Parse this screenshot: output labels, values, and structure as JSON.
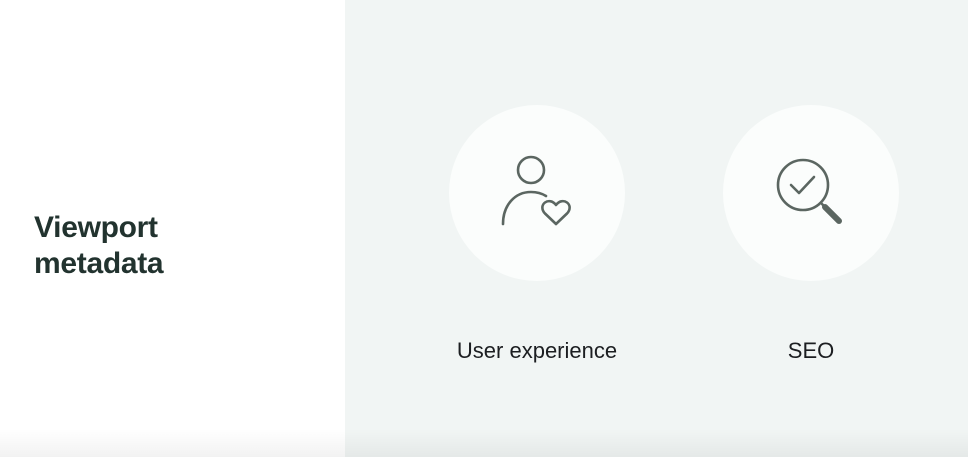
{
  "slide": {
    "title_lines": [
      "Viewport",
      "metadata"
    ]
  },
  "features": [
    {
      "label": "User experience",
      "icon": "user-heart-icon"
    },
    {
      "label": "SEO",
      "icon": "search-check-icon"
    }
  ],
  "colors": {
    "left_background": "#ffffff",
    "right_background": "#f1f5f4",
    "circle_fill": "#fbfdfc",
    "icon_stroke": "#5b6661",
    "title_text": "#22332f",
    "label_text": "#1c1e21"
  }
}
